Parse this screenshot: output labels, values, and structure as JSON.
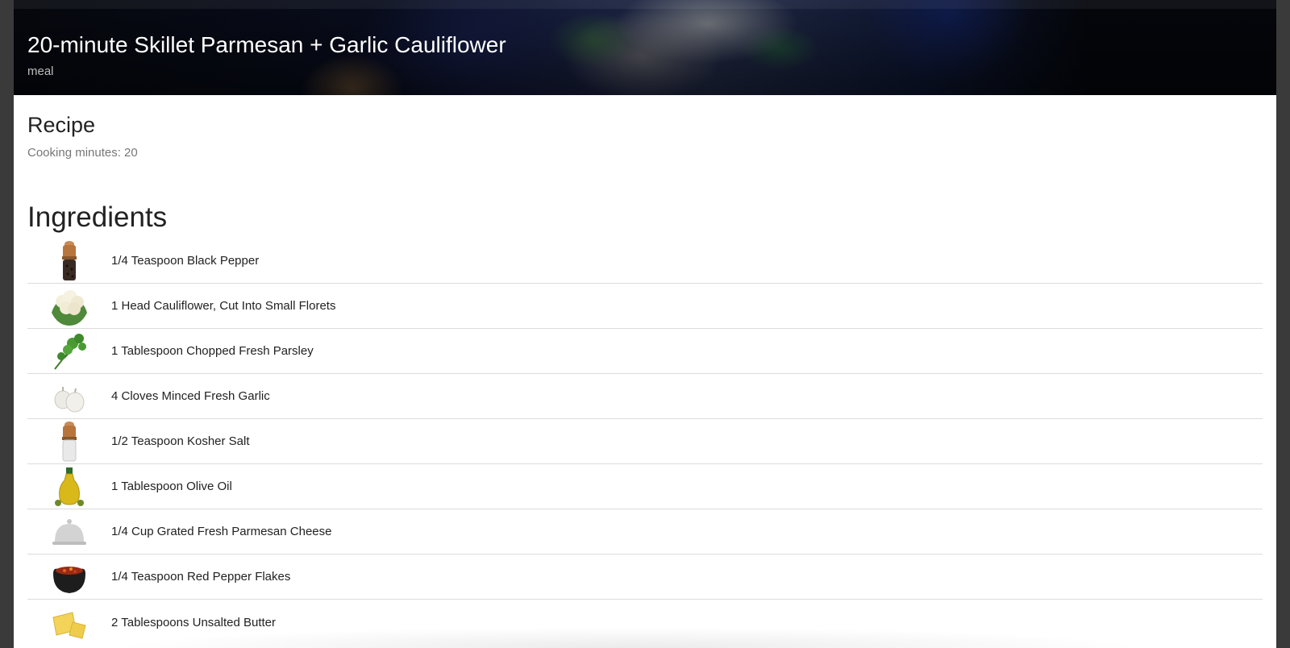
{
  "header": {
    "title": "20-minute Skillet Parmesan + Garlic Cauliflower",
    "category": "meal"
  },
  "recipe": {
    "heading": "Recipe",
    "cooking_minutes": "Cooking minutes: 20"
  },
  "ingredients": {
    "heading": "Ingredients",
    "items": [
      {
        "label": "1/4 Teaspoon Black Pepper",
        "icon": "pepper-grinder-icon"
      },
      {
        "label": "1 Head Cauliflower, Cut Into Small Florets",
        "icon": "cauliflower-icon"
      },
      {
        "label": "1 Tablespoon Chopped Fresh Parsley",
        "icon": "parsley-icon"
      },
      {
        "label": "4 Cloves Minced Fresh Garlic",
        "icon": "garlic-icon"
      },
      {
        "label": "1/2 Teaspoon Kosher Salt",
        "icon": "salt-shaker-icon"
      },
      {
        "label": "1 Tablespoon Olive Oil",
        "icon": "olive-oil-icon"
      },
      {
        "label": "1/4 Cup Grated Fresh Parmesan Cheese",
        "icon": "cloche-icon"
      },
      {
        "label": "1/4 Teaspoon Red Pepper Flakes",
        "icon": "red-pepper-flakes-icon"
      },
      {
        "label": "2 Tablespoons Unsalted Butter",
        "icon": "butter-icon"
      }
    ]
  }
}
